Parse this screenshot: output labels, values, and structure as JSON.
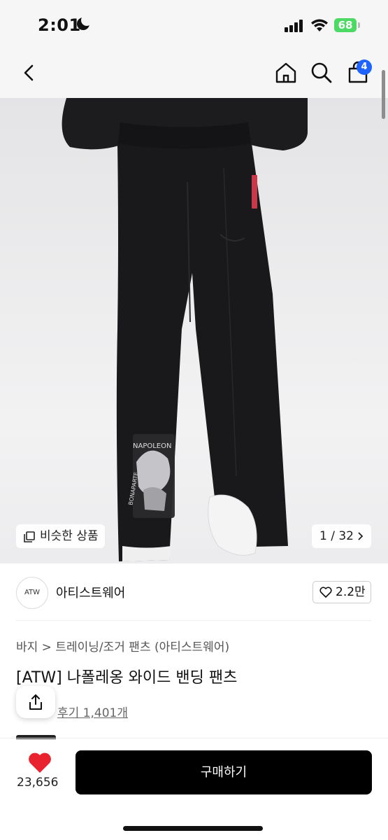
{
  "status_bar": {
    "time": "2:01",
    "battery": "68"
  },
  "nav": {
    "cart_count": "4"
  },
  "hero": {
    "similar_label": "비슷한 상품",
    "counter": "1 / 32",
    "print_text_1": "NAPOLEON",
    "print_text_2": "BONAPARTE"
  },
  "brand": {
    "logo_text": "ATW",
    "name": "아티스트웨어",
    "like_count": "2.2만"
  },
  "product": {
    "breadcrumb": "바지 > 트레이닝/조거 팬츠 (아티스트웨어)",
    "title": "[ATW] 나폴레옹 와이드 밴딩 팬츠",
    "reviews": "후기 1,401개"
  },
  "bottom_bar": {
    "wish_count": "23,656",
    "buy_label": "구매하기"
  },
  "colors": {
    "accent": "#1e62ff",
    "heart": "#e8222e",
    "battery": "#4cd964",
    "buy_button": "#000000"
  }
}
